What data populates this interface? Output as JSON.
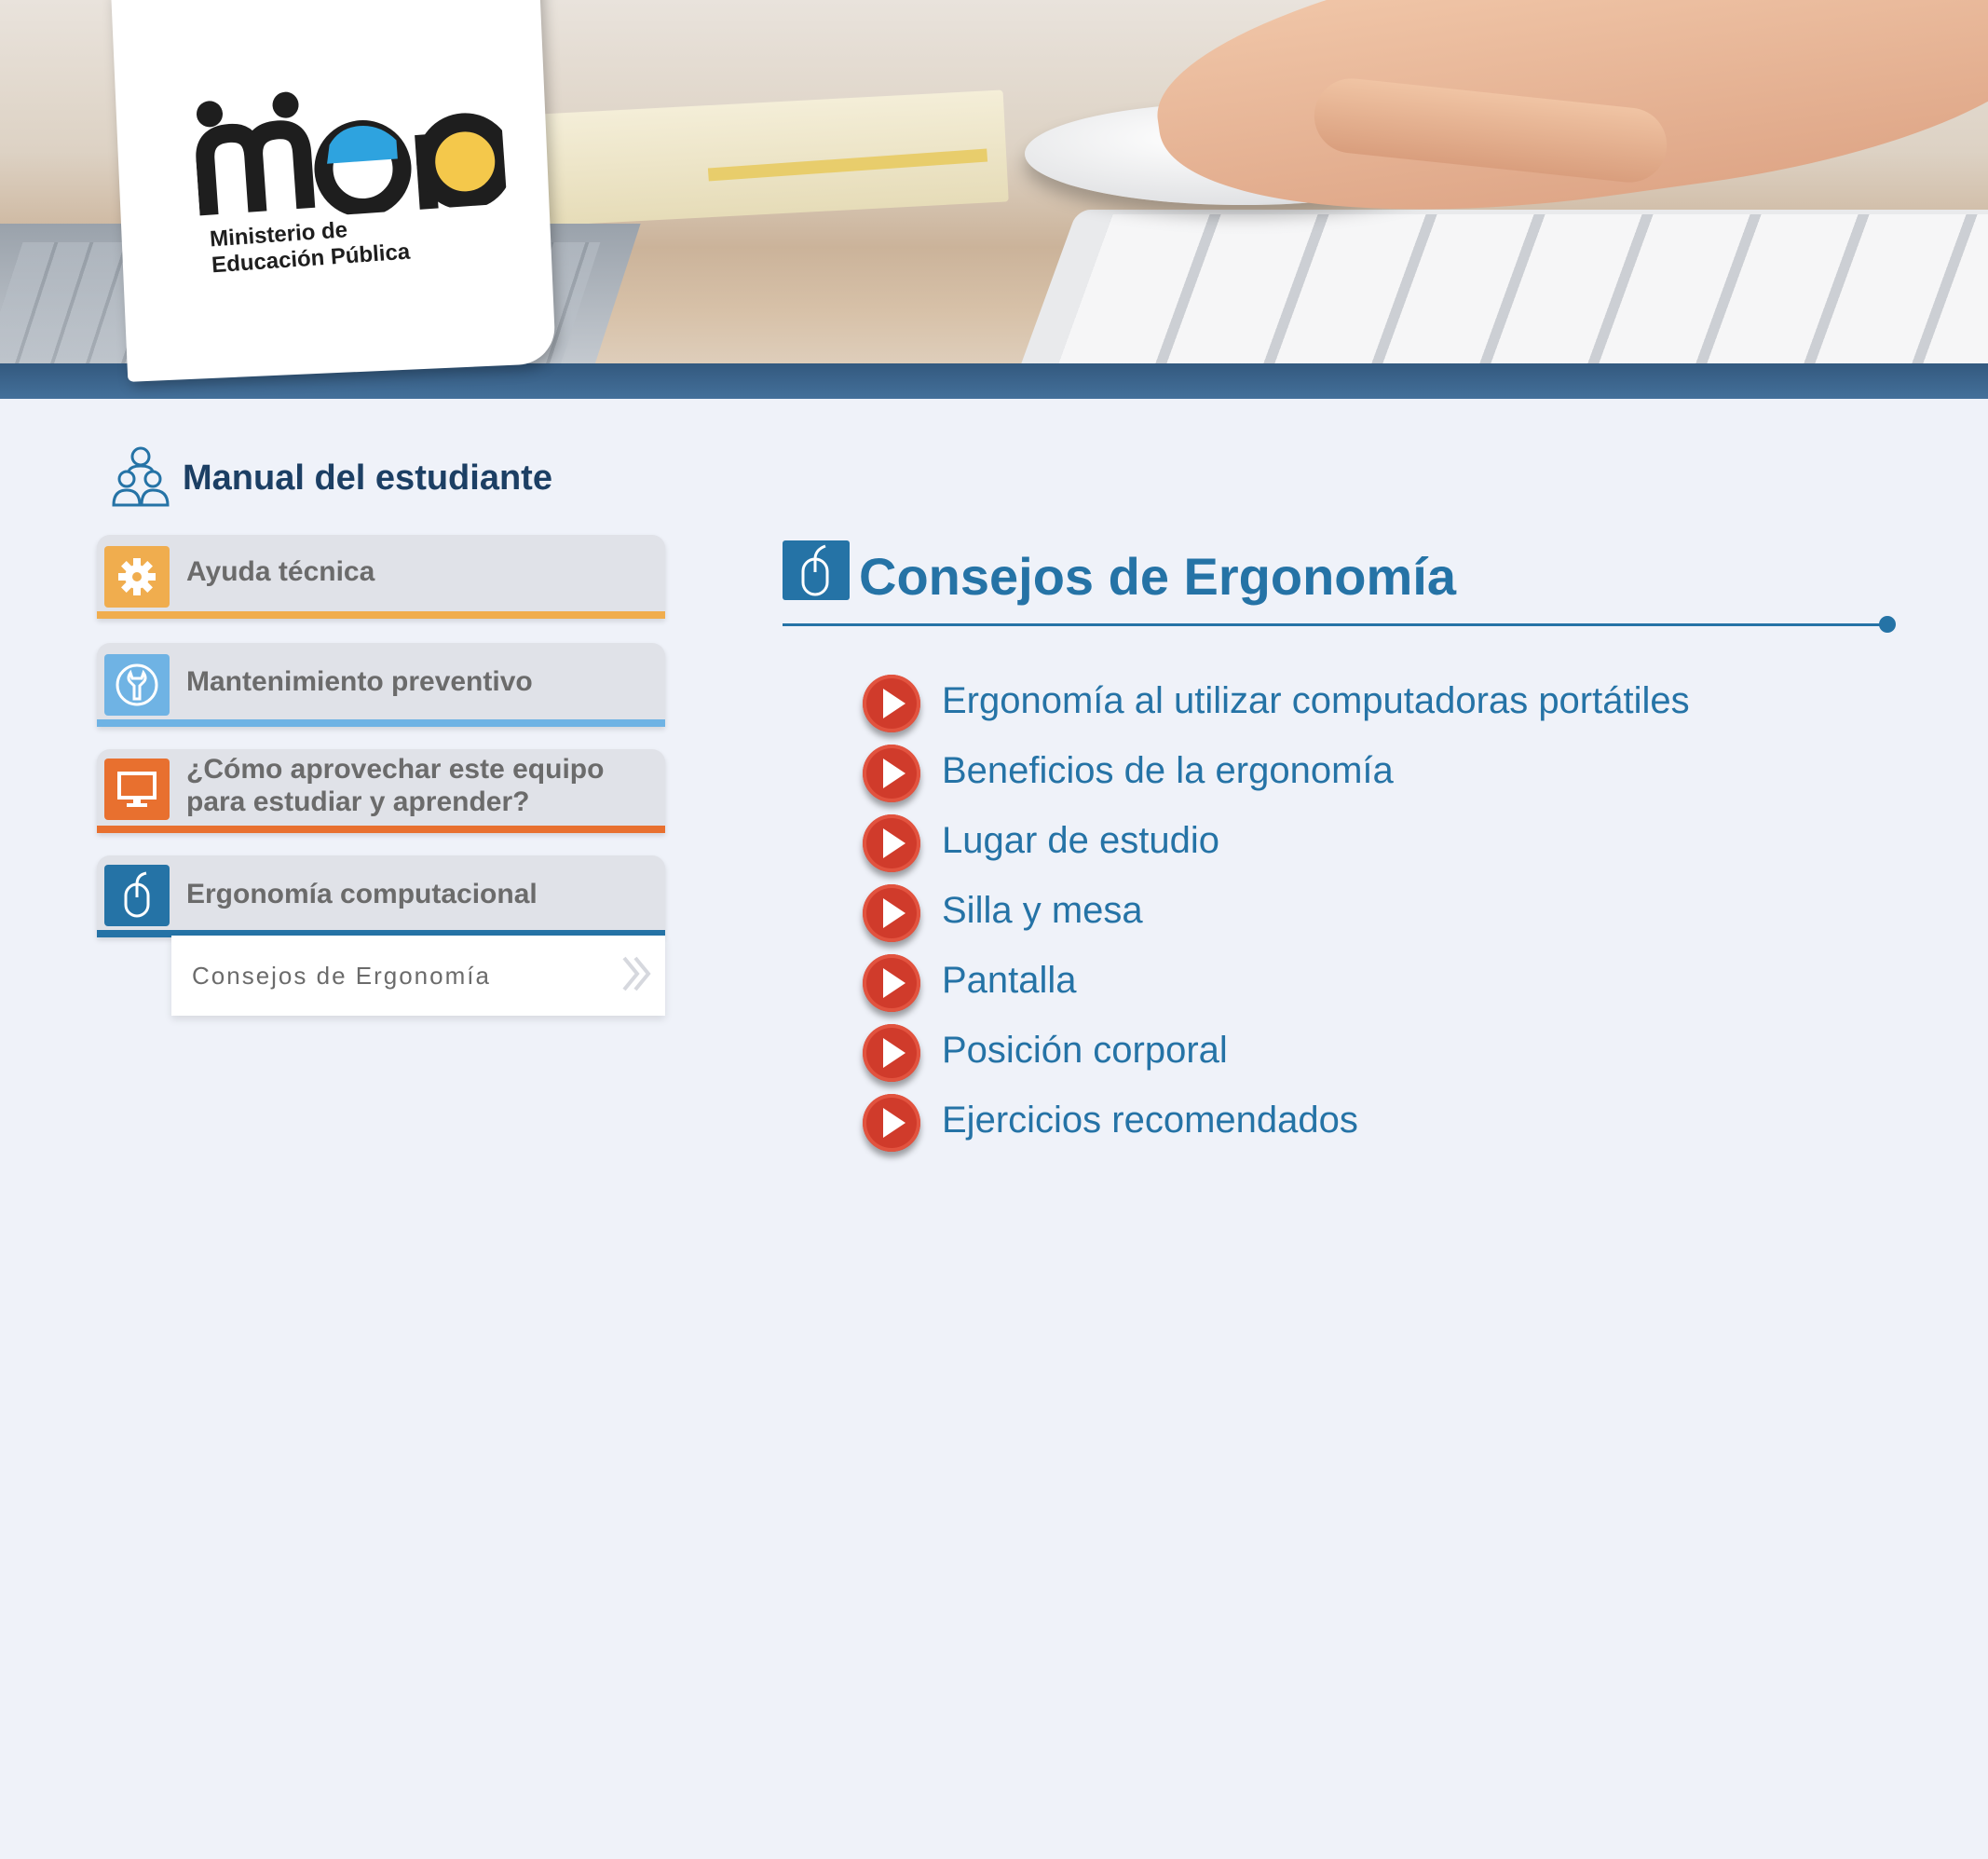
{
  "header": {
    "logo": {
      "wordmark": "mep",
      "subtitle_line1": "Ministerio de",
      "subtitle_line2": "Educación Pública"
    }
  },
  "sidebar": {
    "title": "Manual del estudiante",
    "items": [
      {
        "label": "Ayuda técnica",
        "icon": "gear-icon",
        "color": "#f0ad4e"
      },
      {
        "label": "Mantenimiento preventivo",
        "icon": "wrench-icon",
        "color": "#6fb3e4"
      },
      {
        "label": "¿Cómo aprovechar este equipo para estudiar y aprender?",
        "icon": "monitor-icon",
        "color": "#e8702f"
      },
      {
        "label": "Ergonomía computacional",
        "icon": "mouse-icon",
        "color": "#2573a6"
      }
    ],
    "subitems": [
      {
        "label": "Consejos de Ergonomía",
        "icon": "double-chevron-right-icon"
      }
    ]
  },
  "main": {
    "title": "Consejos de Ergonomía",
    "icon": "mouse-icon",
    "accent": "#2573a6",
    "topics": [
      "Ergonomía al utilizar computadoras portátiles",
      "Beneficios de la ergonomía",
      "Lugar de estudio",
      "Silla y mesa",
      "Pantalla",
      "Posición corporal",
      "Ejercicios recomendados"
    ]
  }
}
